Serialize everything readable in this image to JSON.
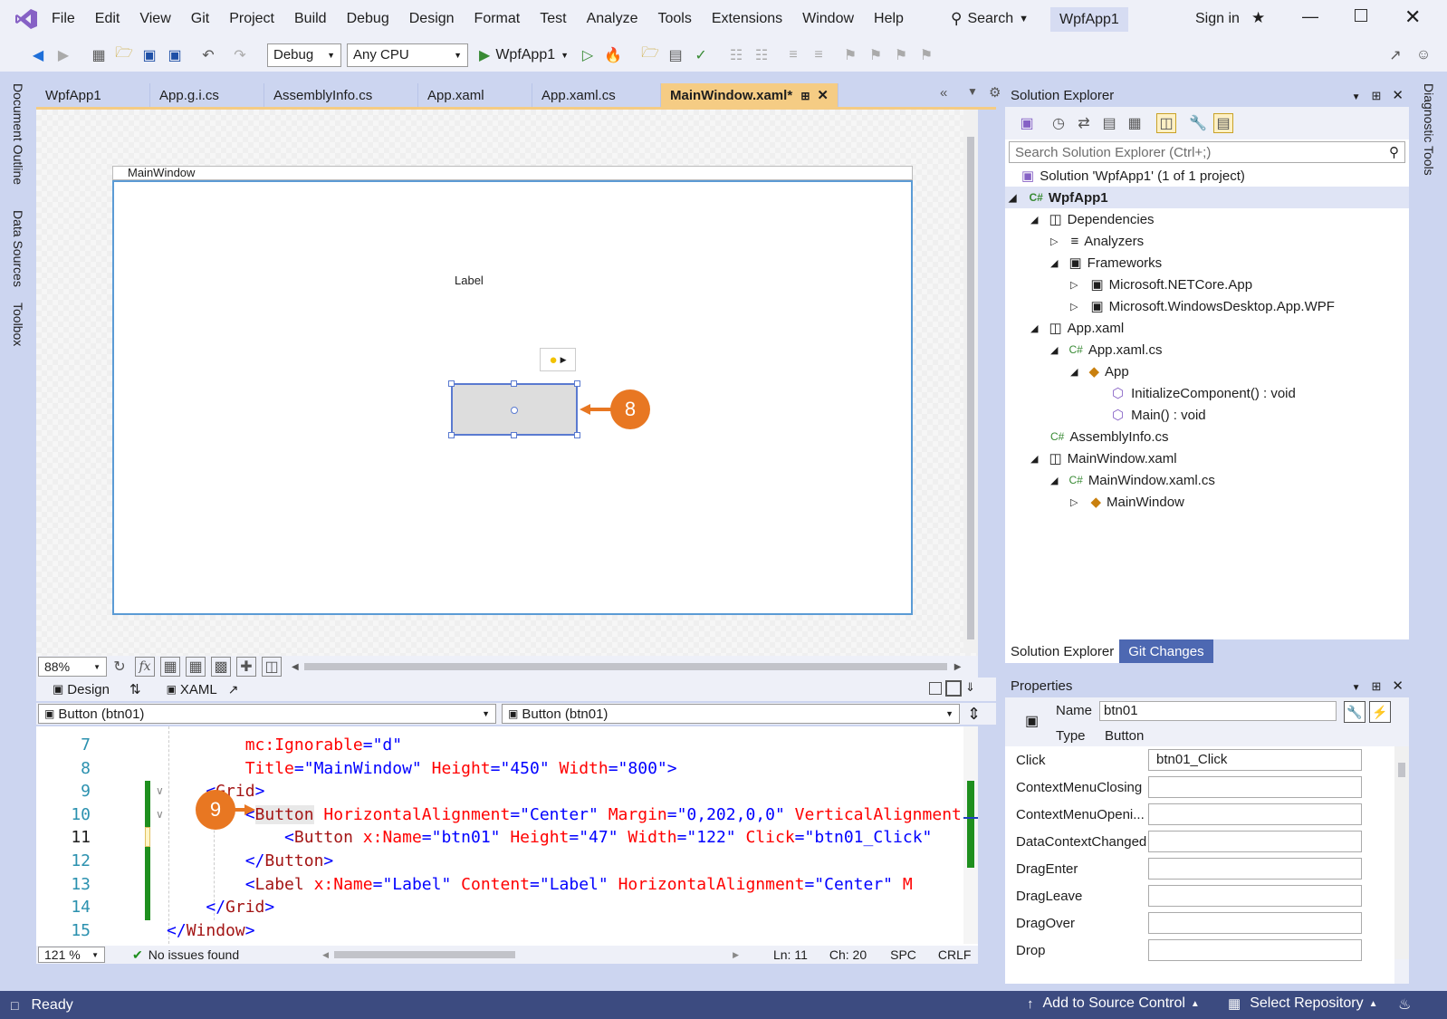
{
  "menu": [
    "File",
    "Edit",
    "View",
    "Git",
    "Project",
    "Build",
    "Debug",
    "Design",
    "Format",
    "Test",
    "Analyze",
    "Tools",
    "Extensions",
    "Window",
    "Help"
  ],
  "search_label": "Search",
  "app_name": "WpfApp1",
  "signin_label": "Sign in",
  "toolbar": {
    "config": "Debug",
    "platform": "Any CPU",
    "run_label": "WpfApp1"
  },
  "tabs": [
    "WpfApp1",
    "App.g.i.cs",
    "AssemblyInfo.cs",
    "App.xaml",
    "App.xaml.cs",
    "MainWindow.xaml*"
  ],
  "left_side_tabs": [
    "Document Outline",
    "Data Sources",
    "Toolbox"
  ],
  "right_side_tab": "Diagnostic Tools",
  "designer": {
    "window_title": "MainWindow",
    "label_text": "Label",
    "zoom": "88%",
    "design_tab": "Design",
    "xaml_tab": "XAML",
    "left_nav": "Button (btn01)",
    "right_nav": "Button (btn01)"
  },
  "callouts": {
    "eight": "8",
    "nine": "9"
  },
  "code": {
    "line_numbers": [
      "7",
      "8",
      "9",
      "10",
      "11",
      "12",
      "13",
      "14",
      "15"
    ],
    "zoom": "121 %",
    "status": "No issues found",
    "ln": "Ln: 11",
    "ch": "Ch: 20",
    "spc": "SPC",
    "crlf": "CRLF"
  },
  "solution_explorer": {
    "title": "Solution Explorer",
    "search_placeholder": "Search Solution Explorer (Ctrl+;)",
    "items": [
      "Solution 'WpfApp1' (1 of 1 project)",
      "WpfApp1",
      "Dependencies",
      "Analyzers",
      "Frameworks",
      "Microsoft.NETCore.App",
      "Microsoft.WindowsDesktop.App.WPF",
      "App.xaml",
      "App.xaml.cs",
      "App",
      "InitializeComponent() : void",
      "Main() : void",
      "AssemblyInfo.cs",
      "MainWindow.xaml",
      "MainWindow.xaml.cs",
      "MainWindow"
    ],
    "bottom_tabs": [
      "Solution Explorer",
      "Git Changes"
    ]
  },
  "properties": {
    "title": "Properties",
    "name_label": "Name",
    "name_value": "btn01",
    "type_label": "Type",
    "type_value": "Button",
    "events": [
      "Click",
      "ContextMenuClosing",
      "ContextMenuOpeni...",
      "DataContextChanged",
      "DragEnter",
      "DragLeave",
      "DragOver",
      "Drop"
    ],
    "click_value": "btn01_Click"
  },
  "statusbar": {
    "ready": "Ready",
    "source_control": "Add to Source Control",
    "repo": "Select Repository"
  },
  "colors": {
    "accent": "#e87722",
    "status_bar": "#3c4b80",
    "vs_purple": "#8661c5"
  }
}
